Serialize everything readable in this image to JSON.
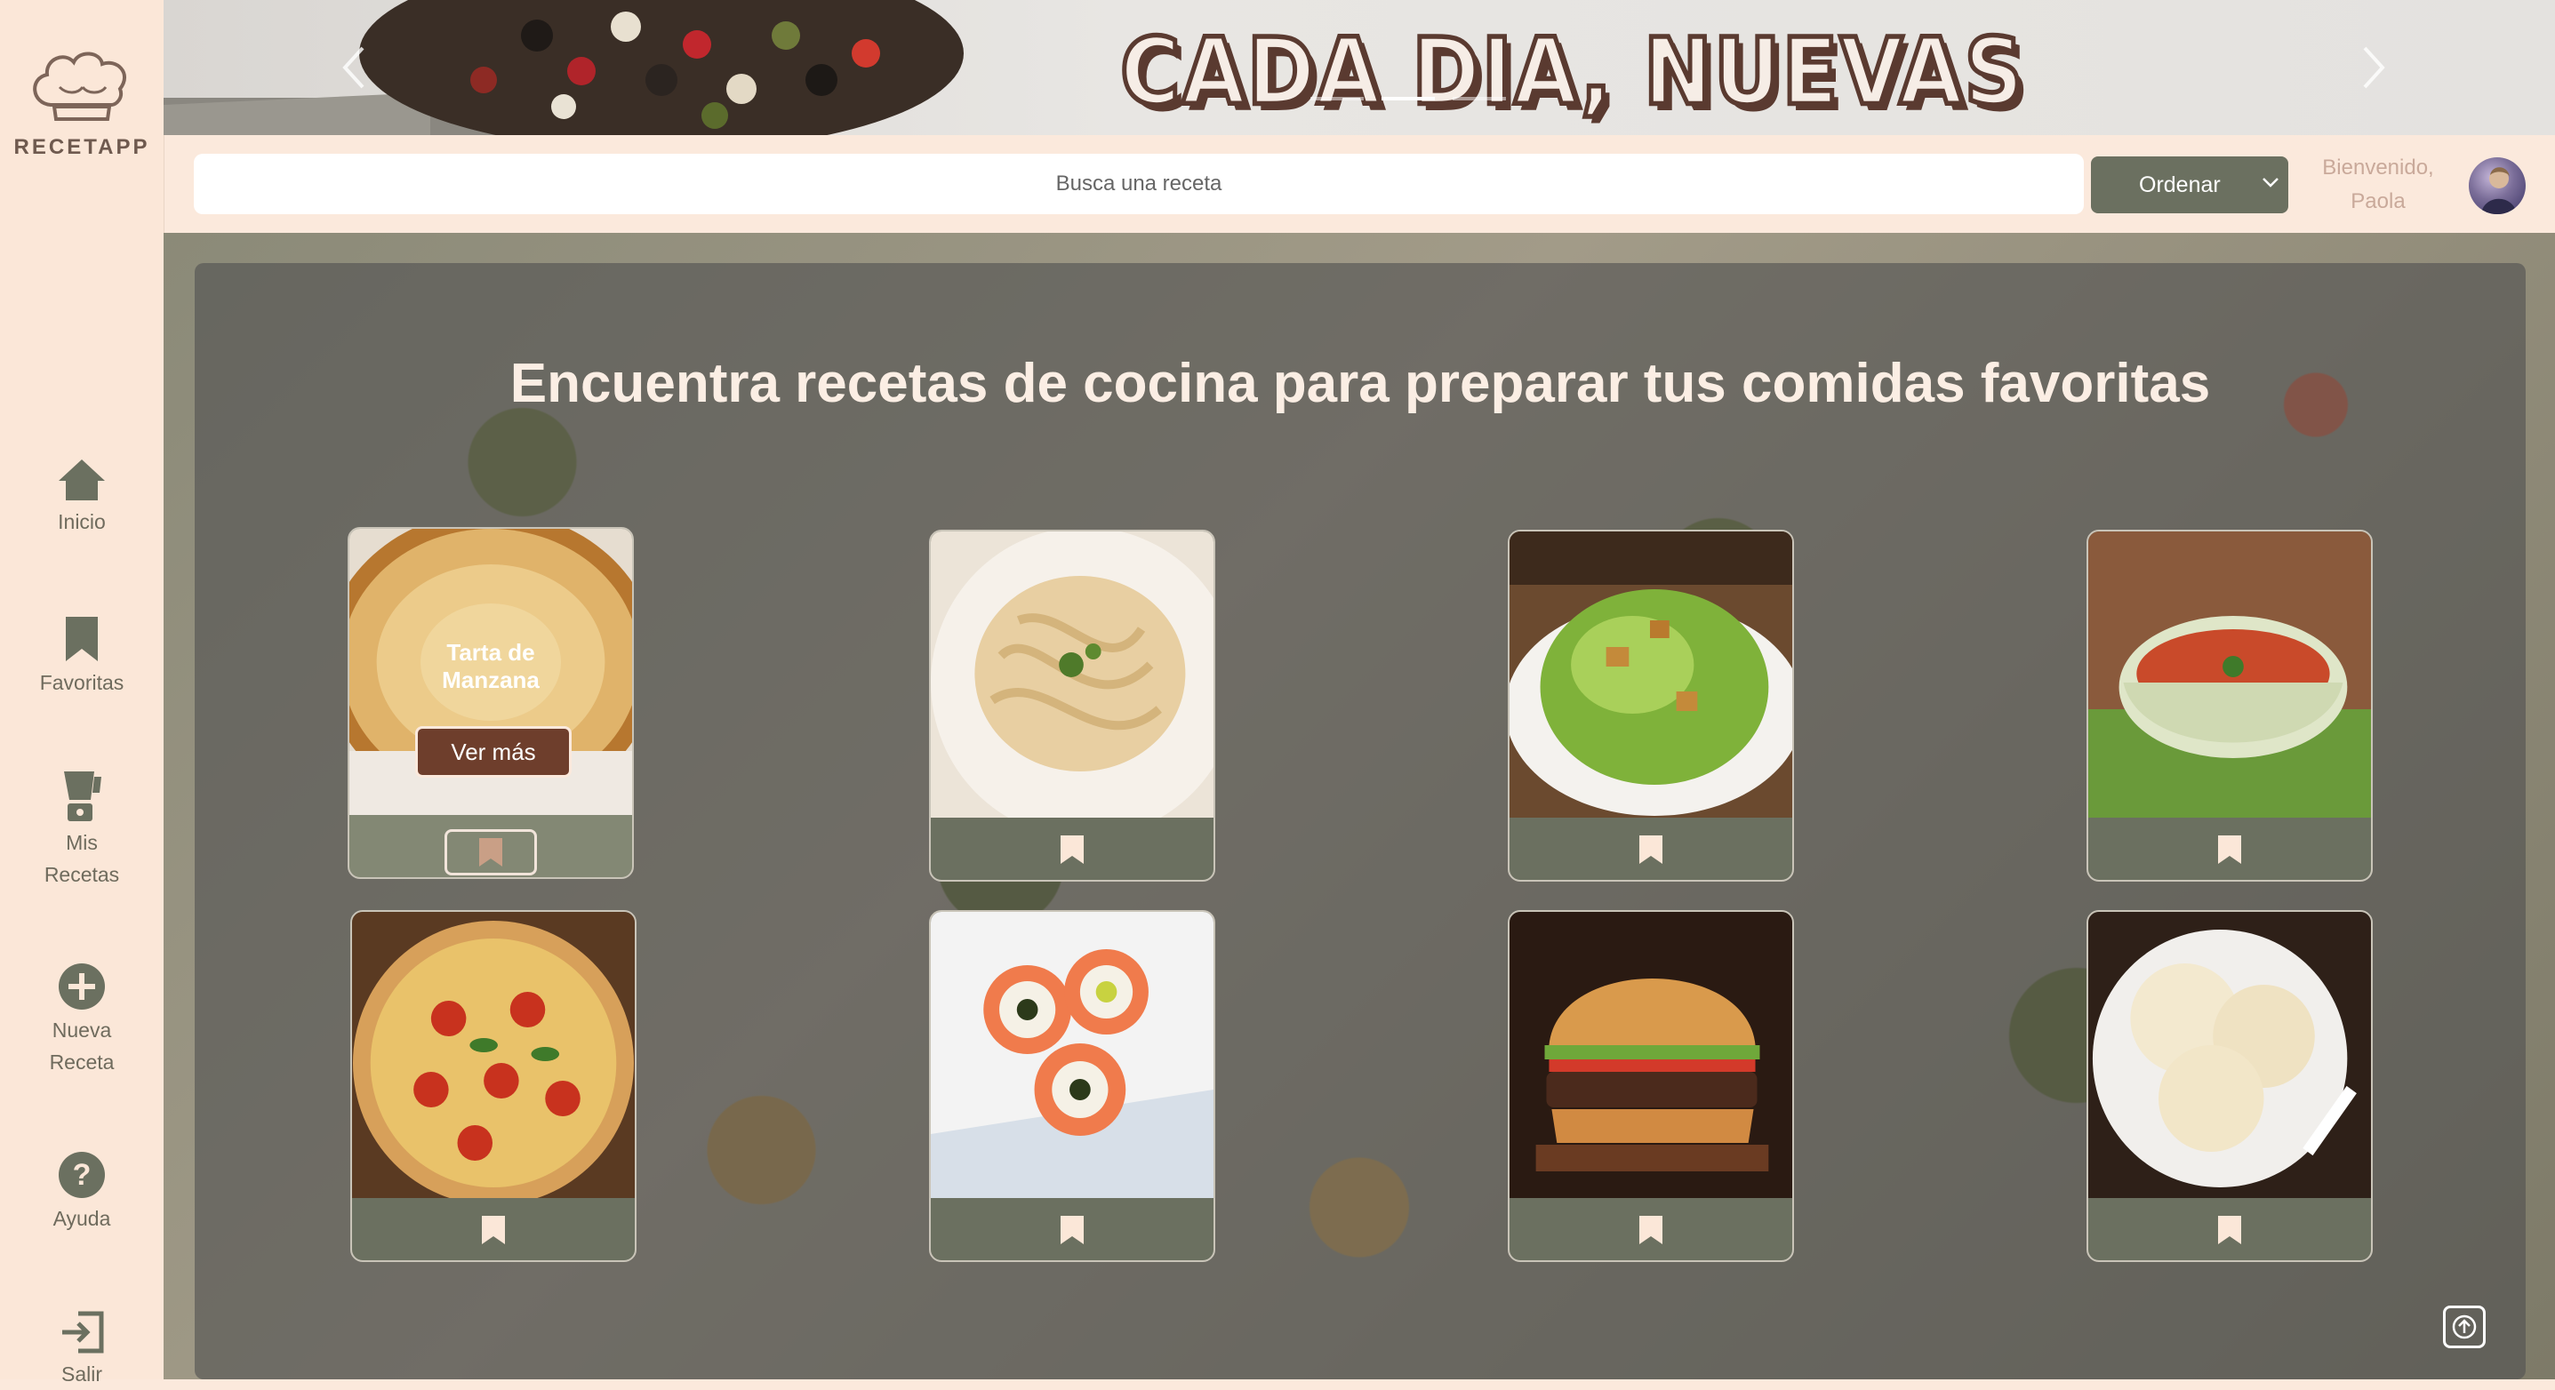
{
  "app": {
    "name": "RECETAPP"
  },
  "sidebar": {
    "items": [
      {
        "label": "Inicio",
        "icon": "home-icon"
      },
      {
        "label": "Favoritas",
        "icon": "bookmark-icon"
      },
      {
        "label": "Mis\nRecetas",
        "label_line1": "Mis",
        "label_line2": "Recetas",
        "icon": "blender-icon"
      },
      {
        "label_line1": "Nueva",
        "label_line2": "Receta",
        "icon": "plus-circle-icon"
      },
      {
        "label": "Ayuda",
        "icon": "help-icon"
      },
      {
        "label": "Salir",
        "icon": "logout-icon"
      }
    ]
  },
  "banner": {
    "title": "CADA DIA, NUEVAS RECETAS"
  },
  "header": {
    "search_placeholder": "Busca una receta",
    "sort_label": "Ordenar",
    "welcome_line1": "Bienvenido,",
    "welcome_line2": "Paola"
  },
  "main": {
    "heading": "Encuentra recetas de cocina para preparar tus comidas favoritas",
    "cards": [
      {
        "title_line1": "Tarta de",
        "title_line2": "Manzana",
        "button": "Ver más",
        "image": "apple-tart"
      },
      {
        "image": "fettuccine-alfredo"
      },
      {
        "image": "caesar-salad"
      },
      {
        "image": "tomato-soup"
      },
      {
        "image": "pizza"
      },
      {
        "image": "sushi-rolls"
      },
      {
        "image": "burger"
      },
      {
        "image": "vanilla-ice-cream"
      }
    ]
  },
  "colors": {
    "sidebar_bg": "#fbe7d8",
    "accent_olive": "#6b7060",
    "brand_brown": "#5a3a30",
    "welcome_text": "#c9a99a"
  }
}
